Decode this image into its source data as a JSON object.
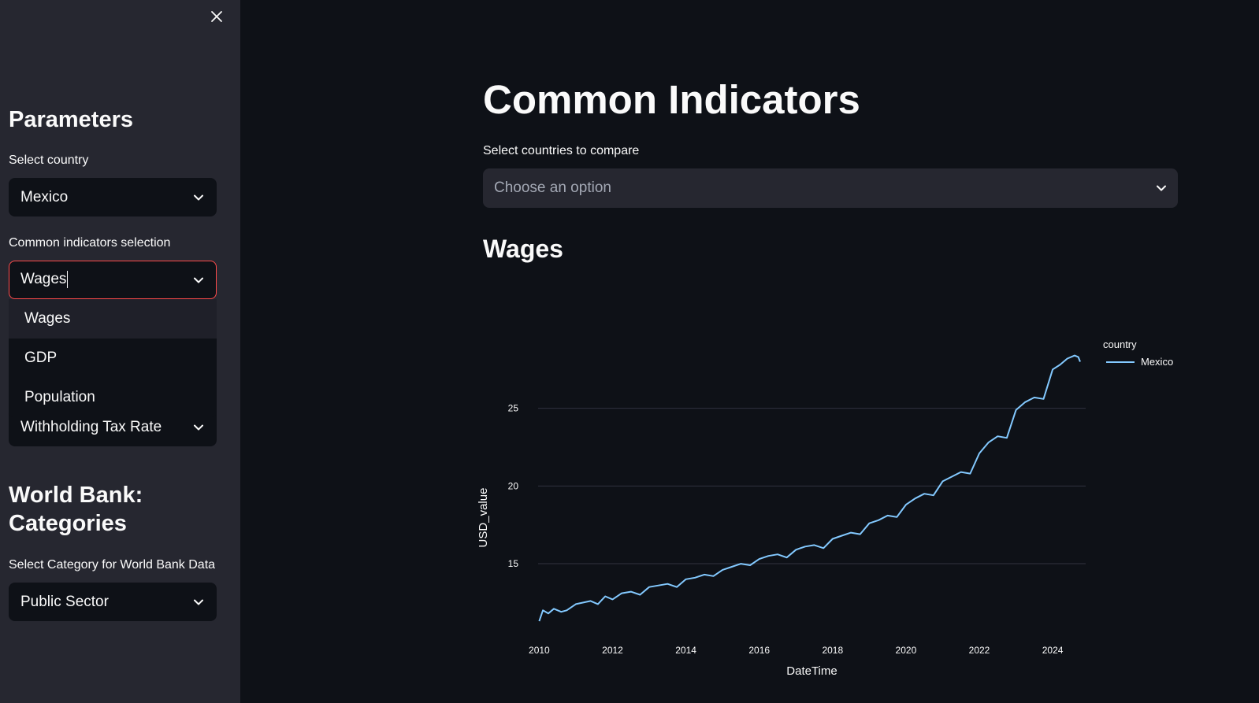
{
  "sidebar": {
    "parameters_heading": "Parameters",
    "country_label": "Select country",
    "country_value": "Mexico",
    "indicator_label": "Common indicators selection",
    "indicator_input": "Wages",
    "indicator_options": [
      "Wages",
      "GDP",
      "Population"
    ],
    "tax_rate_value": "Withholding Tax Rate",
    "worldbank_heading_line1": "World Bank:",
    "worldbank_heading_line2": "Categories",
    "category_label": "Select Category for World Bank Data",
    "category_value": "Public Sector",
    "icons": {
      "close": "close-icon",
      "chevron": "chevron-down-icon"
    }
  },
  "main": {
    "title": "Common Indicators",
    "compare_label": "Select countries to compare",
    "compare_placeholder": "Choose an option",
    "section_title": "Wages"
  },
  "colors": {
    "background": "#0e1117",
    "sidebar": "#262730",
    "accent": "#ff4b4b",
    "line": "#83c9ff"
  },
  "chart_data": {
    "type": "line",
    "title": "",
    "xlabel": "DateTime",
    "ylabel": "USD_value",
    "x_ticks": [
      "2010",
      "2012",
      "2014",
      "2016",
      "2018",
      "2020",
      "2022",
      "2024"
    ],
    "y_ticks": [
      "15",
      "20",
      "25"
    ],
    "xlim": [
      2009.97,
      2024.9
    ],
    "ylim": [
      11,
      30
    ],
    "grid": true,
    "legend_title": "country",
    "legend_position": "top-right",
    "series": [
      {
        "name": "Mexico",
        "color": "#83c9ff",
        "x": [
          2010.0,
          2010.1,
          2010.25,
          2010.4,
          2010.6,
          2010.75,
          2011.0,
          2011.2,
          2011.4,
          2011.6,
          2011.8,
          2012.0,
          2012.25,
          2012.5,
          2012.75,
          2013.0,
          2013.25,
          2013.5,
          2013.75,
          2014.0,
          2014.25,
          2014.5,
          2014.75,
          2015.0,
          2015.25,
          2015.5,
          2015.75,
          2016.0,
          2016.25,
          2016.5,
          2016.75,
          2017.0,
          2017.25,
          2017.5,
          2017.75,
          2018.0,
          2018.25,
          2018.5,
          2018.75,
          2019.0,
          2019.25,
          2019.5,
          2019.75,
          2020.0,
          2020.25,
          2020.5,
          2020.75,
          2021.0,
          2021.25,
          2021.5,
          2021.75,
          2022.0,
          2022.25,
          2022.5,
          2022.75,
          2023.0,
          2023.25,
          2023.5,
          2023.75,
          2024.0,
          2024.2,
          2024.4,
          2024.6,
          2024.7,
          2024.75
        ],
        "values": [
          11.3,
          12.0,
          11.8,
          12.1,
          11.9,
          12.0,
          12.4,
          12.5,
          12.6,
          12.4,
          12.9,
          12.7,
          13.1,
          13.2,
          13.0,
          13.5,
          13.6,
          13.7,
          13.5,
          14.0,
          14.1,
          14.3,
          14.2,
          14.6,
          14.8,
          15.0,
          14.9,
          15.3,
          15.5,
          15.6,
          15.4,
          15.9,
          16.1,
          16.2,
          16.0,
          16.6,
          16.8,
          17.0,
          16.9,
          17.6,
          17.8,
          18.1,
          18.0,
          18.8,
          19.2,
          19.5,
          19.4,
          20.3,
          20.6,
          20.9,
          20.8,
          22.1,
          22.8,
          23.2,
          23.1,
          24.9,
          25.4,
          25.7,
          25.6,
          27.5,
          27.8,
          28.2,
          28.4,
          28.3,
          28.0
        ]
      }
    ]
  }
}
